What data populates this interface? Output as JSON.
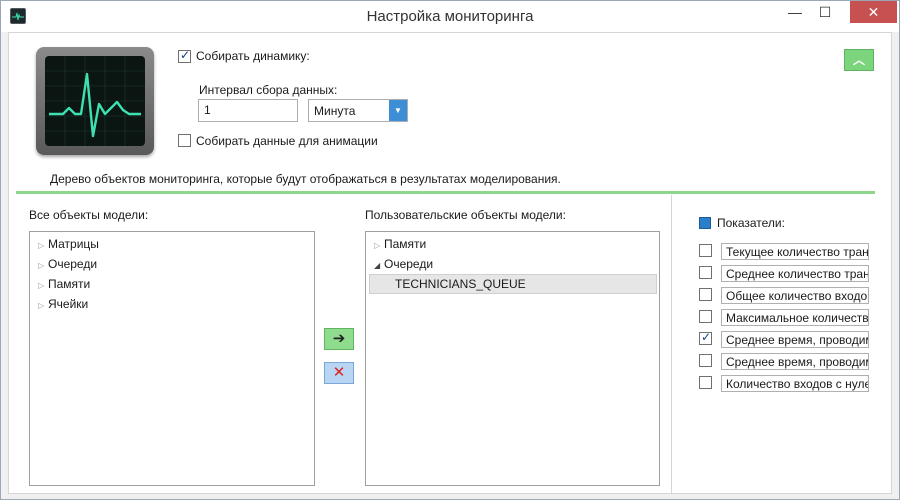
{
  "window": {
    "title": "Настройка мониторинга",
    "min_glyph": "—",
    "max_glyph": "☐",
    "close_glyph": "✕"
  },
  "settings": {
    "collect_dynamics": {
      "label": "Собирать динамику:",
      "checked": true
    },
    "interval_label": "Интервал сбора данных:",
    "interval_value": "1",
    "interval_unit": "Минута",
    "collect_animation": {
      "label": "Собирать данные для анимации",
      "checked": false
    },
    "collapse_glyph": "︿"
  },
  "hint": "Дерево объектов мониторинга, которые будут отображаться в результатах моделирования.",
  "all_objects": {
    "label": "Все объекты модели:",
    "items": [
      "Матрицы",
      "Очереди",
      "Памяти",
      "Ячейки"
    ]
  },
  "user_objects": {
    "label": "Пользовательские объекты модели:",
    "items": [
      {
        "label": "Памяти",
        "expanded": false
      },
      {
        "label": "Очереди",
        "expanded": true,
        "children": [
          "TECHNICIANS_QUEUE"
        ]
      }
    ]
  },
  "buttons": {
    "add_glyph": "➔",
    "remove_glyph": "✕"
  },
  "indicators": {
    "label": "Показатели:",
    "items": [
      {
        "label": "Текущее количество тран",
        "checked": false
      },
      {
        "label": "Среднее количество тран",
        "checked": false
      },
      {
        "label": "Общее количество входов",
        "checked": false
      },
      {
        "label": "Максимальное количеств",
        "checked": false
      },
      {
        "label": "Среднее время, проводим",
        "checked": true
      },
      {
        "label": "Среднее время, проводим",
        "checked": false
      },
      {
        "label": "Количество входов с нуле",
        "checked": false
      }
    ]
  },
  "colors": {
    "accent_green": "#8ed68e",
    "accent_blue": "#3e8ed6",
    "close_red": "#c75050",
    "monitor_line": "#3fe0b0"
  }
}
